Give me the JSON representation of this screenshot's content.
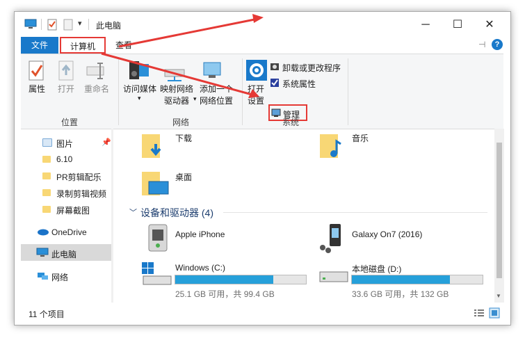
{
  "window": {
    "title": "此电脑"
  },
  "tabs": {
    "file": "文件",
    "computer": "计算机",
    "view": "查看"
  },
  "ribbon": {
    "location": {
      "label": "位置",
      "items": [
        "属性",
        "打开",
        "重命名"
      ]
    },
    "network": {
      "label": "网络",
      "access_media": "访问媒体",
      "map_drive": [
        "映射网络",
        "驱动器"
      ],
      "add_location": [
        "添加一个",
        "网络位置"
      ]
    },
    "system": {
      "label": "系统",
      "open_settings": [
        "打开",
        "设置"
      ],
      "uninstall": "卸载或更改程序",
      "properties": "系统属性",
      "manage": "管理"
    }
  },
  "sidebar": {
    "items": [
      {
        "label": "图片"
      },
      {
        "label": "6.10"
      },
      {
        "label": "PR剪辑配乐"
      },
      {
        "label": "录制剪辑视频"
      },
      {
        "label": "屏幕截图"
      },
      {
        "label": "OneDrive"
      },
      {
        "label": "此电脑"
      },
      {
        "label": "网络"
      }
    ]
  },
  "content": {
    "folders": [
      {
        "label": "下载"
      },
      {
        "label": "音乐"
      },
      {
        "label": "桌面"
      }
    ],
    "devices_header": "设备和驱动器 (4)",
    "devices": [
      {
        "name": "Apple iPhone"
      },
      {
        "name": "Galaxy On7 (2016)"
      }
    ],
    "drives": [
      {
        "name": "Windows (C:)",
        "usage": "25.1 GB 可用，共 99.4 GB",
        "used_fraction": 0.75
      },
      {
        "name": "本地磁盘 (D:)",
        "usage": "33.6 GB 可用，共 132 GB",
        "used_fraction": 0.75
      }
    ]
  },
  "status": {
    "count": "11 个项目"
  },
  "colors": {
    "accent": "#1979ca",
    "highlight": "#e53935",
    "drive_fill": "#26a0da"
  }
}
